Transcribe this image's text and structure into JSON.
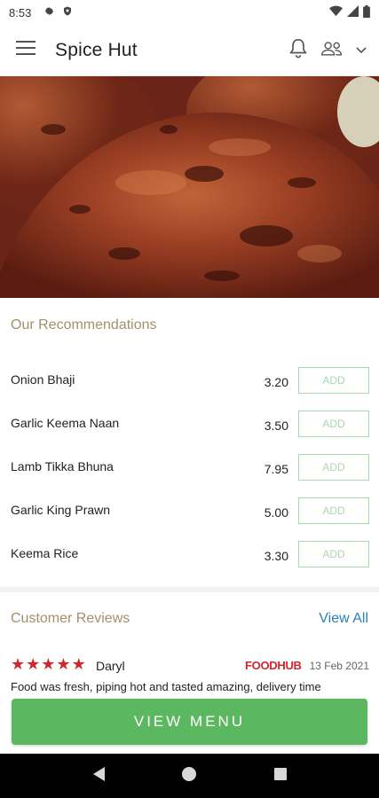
{
  "status_bar": {
    "time": "8:53"
  },
  "app_bar": {
    "title": "Spice Hut"
  },
  "recommendations": {
    "title": "Our Recommendations",
    "add_label": "ADD",
    "items": [
      {
        "name": "Onion Bhaji",
        "price": "3.20"
      },
      {
        "name": "Garlic Keema Naan",
        "price": "3.50"
      },
      {
        "name": "Lamb Tikka Bhuna",
        "price": "7.95"
      },
      {
        "name": "Garlic King Prawn",
        "price": "5.00"
      },
      {
        "name": "Keema Rice",
        "price": "3.30"
      }
    ]
  },
  "reviews": {
    "title": "Customer Reviews",
    "view_all": "View All",
    "items": [
      {
        "stars": 5,
        "reviewer": "Daryl",
        "brand": "FOODHUB",
        "date": "13 Feb 2021",
        "text": "Food was fresh, piping hot and tasted amazing, delivery time"
      }
    ]
  },
  "cta": {
    "view_menu": "VIEW MENU"
  },
  "colors": {
    "accent_green": "#5cb860",
    "add_border": "#a8d8b0",
    "section_title": "#a48f6a",
    "link_blue": "#2a80b9",
    "star_red": "#d0262f"
  }
}
